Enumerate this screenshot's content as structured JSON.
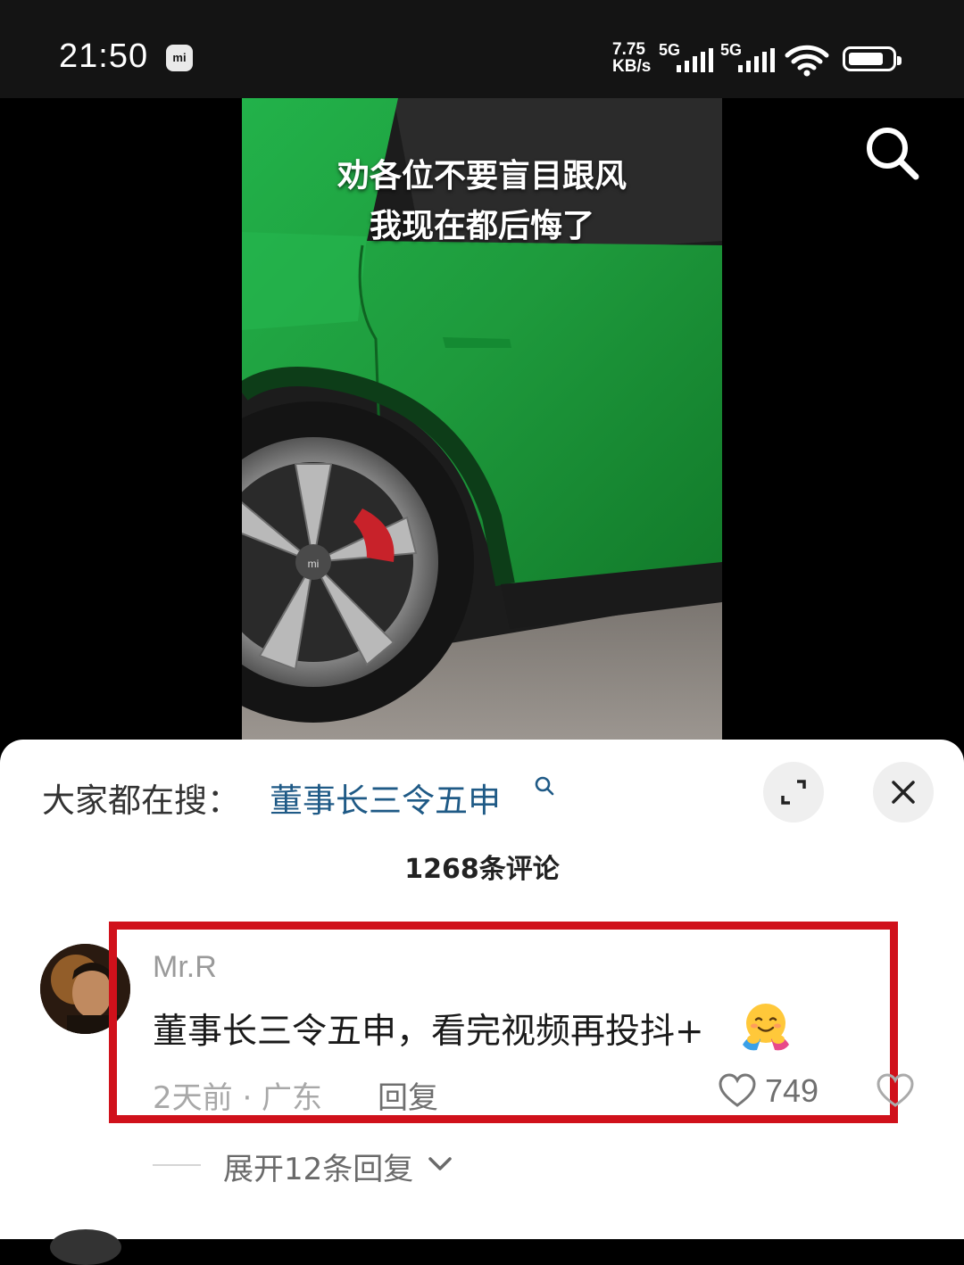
{
  "status_bar": {
    "time": "21:50",
    "app_badge": "mi",
    "net_speed_value": "7.75",
    "net_speed_unit": "KB/s",
    "sim1": "5G",
    "sim2": "5G"
  },
  "video": {
    "caption_line1": "劝各位不要盲目跟风",
    "caption_line2": "我现在都后悔了"
  },
  "comments_panel": {
    "hot_search_label": "大家都在搜：",
    "hot_search_query": "董事长三令五申",
    "comment_count_label": "1268条评论",
    "comment": {
      "username": "Mr.R",
      "text": "董事长三令五申，看完视频再投抖+",
      "time_location": "2天前 · 广东",
      "reply_label": "回复",
      "like_count": "749"
    },
    "expand_replies_label": "展开12条回复"
  },
  "colors": {
    "highlight_border": "#d0111b",
    "link_blue": "#1f5a86",
    "car_green": "#1e9a3c"
  }
}
